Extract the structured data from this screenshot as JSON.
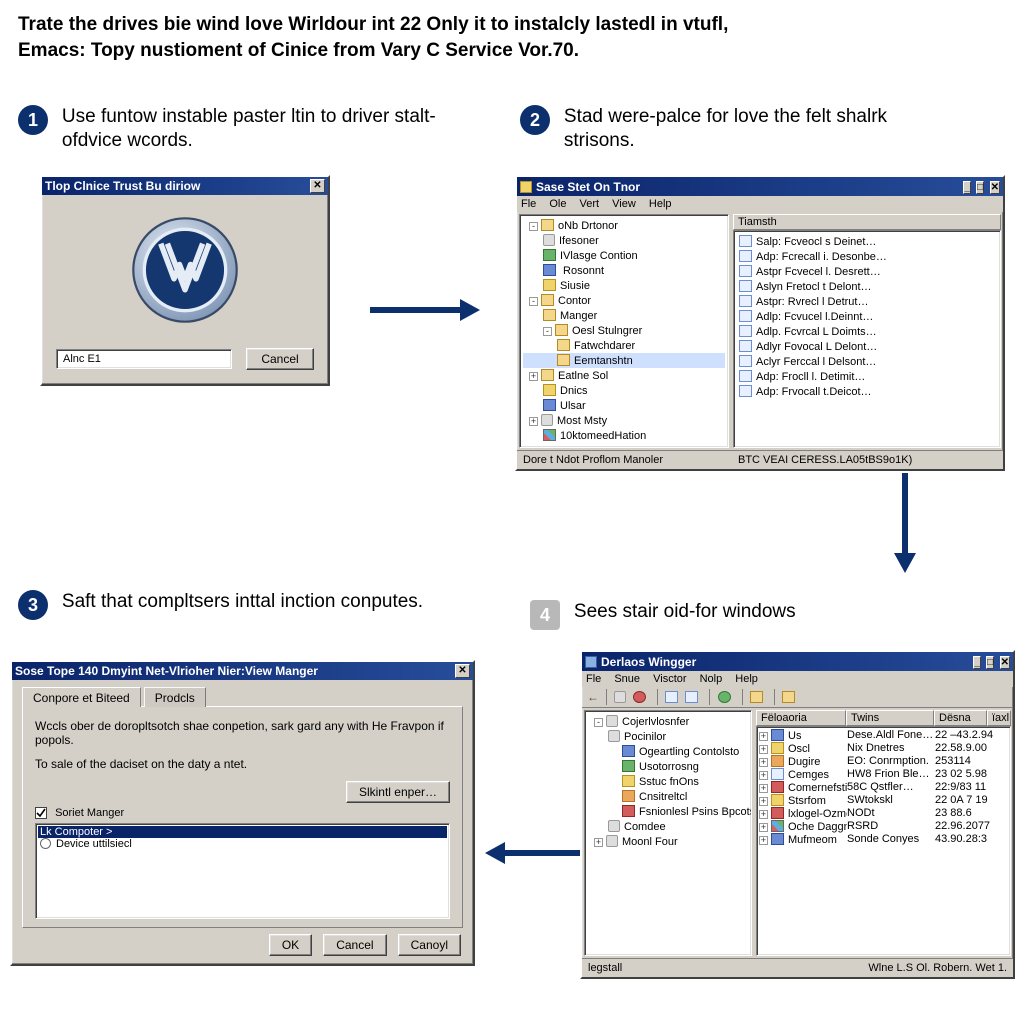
{
  "header_line1": "Trate the drives bie wind love Wirldour int 22 Only it to instalcly lastedl in vtufl,",
  "header_line2": "Emacs: Topy nustioment of Cinice from Vary C Service Vor.70.",
  "steps": {
    "s1": {
      "num": "1",
      "title": "Use funtow instable paster ltin to driver stalt-ofdvice wcords."
    },
    "s2": {
      "num": "2",
      "title": "Stad were-palce for love the felt shalrk strisons."
    },
    "s3": {
      "num": "3",
      "title": "Saft that compltsers inttal inction conputes."
    },
    "s4": {
      "num": "4",
      "title": "Sees stair oid-for windows"
    }
  },
  "win1": {
    "title": "Tlop Clnice Trust Bu diriow",
    "input": "Alnc E1",
    "cancel": "Cancel"
  },
  "win2": {
    "title": "Sase Stet On Tnor",
    "menu": [
      "Fle",
      "Ole",
      "Vert",
      "View",
      "Help"
    ],
    "tree": [
      {
        "lvl": 0,
        "exp": "-",
        "ico": "",
        "label": "oNb Drtonor"
      },
      {
        "lvl": 1,
        "ico": "db",
        "label": "Ifesoner"
      },
      {
        "lvl": 1,
        "ico": "grn",
        "label": "IVlasge Contion"
      },
      {
        "lvl": 1,
        "ico": "blu",
        "label": " Rosonnt"
      },
      {
        "lvl": 1,
        "ico": "yel",
        "label": "Siusie"
      },
      {
        "lvl": 0,
        "exp": "-",
        "ico": "",
        "label": "Contor"
      },
      {
        "lvl": 1,
        "ico": "",
        "label": "Manger"
      },
      {
        "lvl": 1,
        "exp": "-",
        "ico": "",
        "label": "Oesl Stulngrer"
      },
      {
        "lvl": 2,
        "ico": "",
        "label": "Fatwchdarer"
      },
      {
        "lvl": 2,
        "ico": "",
        "label": "Eemtanshtn",
        "sel": true
      },
      {
        "lvl": 0,
        "exp": "+",
        "ico": "",
        "label": "Eatlne Sol"
      },
      {
        "lvl": 1,
        "ico": "yel",
        "label": "Dnics"
      },
      {
        "lvl": 1,
        "ico": "blu",
        "label": "Ulsar"
      },
      {
        "lvl": 0,
        "exp": "+",
        "ico": "db",
        "label": "Most Msty"
      },
      {
        "lvl": 1,
        "ico": "mul",
        "label": "10ktomeedHation"
      }
    ],
    "right_header": "Tiamsth",
    "right": [
      "Salp: Fcveocl s Deinet…",
      "Adp: Fcrecall i. Desonbe…",
      "Astpr Fcvecel l. Desrett…",
      "Aslyn Fretocl t Delont…",
      "Astpr: Rvrecl l Detrut…",
      "Adlp: Fcvucel l.Deinnt…",
      "Adlp. Fcvrcal L Doimts…",
      "Adlyr Fovocal L Delont…",
      "Aclyr Ferccal l Delsont…",
      "Adp: Frocll l. Detimit…",
      "Adp: Frvocall t.Deicot…"
    ],
    "right_icons": [
      "pg",
      "pg",
      "pg",
      "pg",
      "pg",
      "pg",
      "pg",
      "pg",
      "pg",
      "pg",
      "pg"
    ],
    "status_left": "Dore t Ndot Proflom Manoler",
    "status_right": "BTC VEAI CERESS.LA05tBS9o1K)"
  },
  "win3": {
    "title": "Sose Tope 140 Dmyint Net-Vlrioher Nier:View Manger",
    "tabs": [
      "Conpore et Biteed",
      "Prodcls"
    ],
    "body1": "Wccls ober de doropltsotch shae conpetion, sark gard any with He Fravpon if popols.",
    "body2": "To sale of the daciset on the daty a ntet.",
    "setting_btn": "Slkintl enper…",
    "check_label": "Soriet Manger",
    "list": [
      "Lk Compoter >",
      "Device uttilsiecl"
    ],
    "ok": "OK",
    "cancel": "Cancel",
    "apply": "Canoyl"
  },
  "win4": {
    "title": "Derlaos Wingger",
    "menu": [
      "Fle",
      "Snue",
      "Visctor",
      "Nolp",
      "Help"
    ],
    "tree": [
      {
        "lvl": 0,
        "exp": "-",
        "ico": "db",
        "label": "Cojerlvlosnfer"
      },
      {
        "lvl": 1,
        "ico": "db",
        "label": "Pocinilor"
      },
      {
        "lvl": 2,
        "ico": "blu",
        "label": "Ogeartling Contolsto"
      },
      {
        "lvl": 2,
        "ico": "grn",
        "label": "Usotorrosng"
      },
      {
        "lvl": 2,
        "ico": "yel",
        "label": "Sstuc fnOns"
      },
      {
        "lvl": 2,
        "ico": "org",
        "label": "Cnsitreltcl"
      },
      {
        "lvl": 2,
        "ico": "red",
        "label": "Fsnionlesl Psins Bpcotstl"
      },
      {
        "lvl": 1,
        "ico": "db",
        "label": "Comdee"
      },
      {
        "lvl": 0,
        "exp": "+",
        "ico": "db",
        "label": "Moonl Four"
      }
    ],
    "cols": [
      "Fëloaoria",
      "Twins",
      "Dësna",
      "ïaxl"
    ],
    "rows": [
      {
        "ico": "blu",
        "c1": "Us",
        "c2": "Dese.Aldl Fone…",
        "c3": "22 –43.2.94"
      },
      {
        "ico": "yel",
        "c1": "Oscl",
        "c2": "Nix Dnetres",
        "c3": "22.58.9.00"
      },
      {
        "ico": "org",
        "c1": "Dugire",
        "c2": "EO: Conrmption.",
        "c3": "253114"
      },
      {
        "ico": "pg",
        "c1": "Cemges",
        "c2": "HW8 Frion Ble…",
        "c3": "23 02 5.98"
      },
      {
        "ico": "red",
        "c1": "Comernefstil Mem",
        "c2": "58C Qstfler…",
        "c3": "22:9/83 11"
      },
      {
        "ico": "yel",
        "c1": "Stsrfom",
        "c2": "SWtokskl",
        "c3": "22 0A 7 19"
      },
      {
        "ico": "red",
        "c1": "lxlogel-Ozmose",
        "c2": "NODt",
        "c3": "23 88.6"
      },
      {
        "ico": "mul",
        "c1": "Oche Daggn",
        "c2": "RSRD",
        "c3": "22.96.2077"
      },
      {
        "ico": "blu",
        "c1": "Mufmeom",
        "c2": "Sonde Conyes",
        "c3": "43.90.28:3"
      }
    ],
    "status_left": "legstall",
    "status_right": "Wlne L.S Ol.  Robern. Wet 1."
  }
}
